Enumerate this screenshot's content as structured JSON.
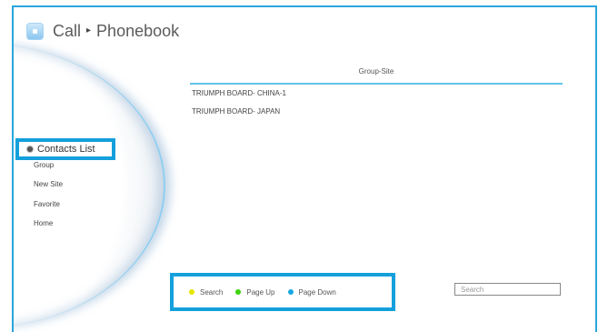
{
  "header": {
    "title_parts": [
      "Call",
      "Phonebook"
    ],
    "separator": "▸"
  },
  "menu": {
    "selected": "Contacts List",
    "items": [
      "Group",
      "New Site",
      "Favorite",
      "Home"
    ]
  },
  "list": {
    "header": "Group-Site",
    "items": [
      "TRIUMPH BOARD- CHINA-1",
      "TRIUMPH BOARD- JAPAN"
    ]
  },
  "actions": [
    {
      "label": "Search",
      "color": "#e6e600"
    },
    {
      "label": "Page Up",
      "color": "#3cd20f"
    },
    {
      "label": "Page Down",
      "color": "#1aa7e0"
    }
  ],
  "search": {
    "placeholder": "Search"
  }
}
